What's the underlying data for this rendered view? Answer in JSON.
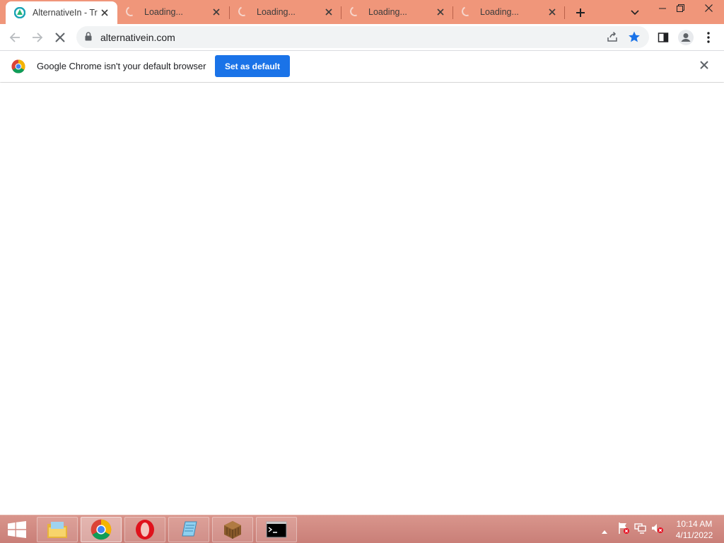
{
  "tabs": [
    {
      "title": "AlternativeIn - Tr",
      "active": true
    },
    {
      "title": "Loading...",
      "active": false
    },
    {
      "title": "Loading...",
      "active": false
    },
    {
      "title": "Loading...",
      "active": false
    },
    {
      "title": "Loading...",
      "active": false
    }
  ],
  "omnibox": {
    "url": "alternativein.com"
  },
  "infobar": {
    "message": "Google Chrome isn't your default browser",
    "button_label": "Set as default"
  },
  "clock": {
    "time": "10:14 AM",
    "date": "4/11/2022"
  },
  "colors": {
    "tabstrip": "#f0967a",
    "accent": "#1a73e8",
    "taskbar": "#d9958c"
  },
  "taskbar_apps": [
    "file-explorer-icon",
    "chrome-icon",
    "opera-icon",
    "notepad-icon",
    "minecraft-icon",
    "cmd-icon"
  ]
}
